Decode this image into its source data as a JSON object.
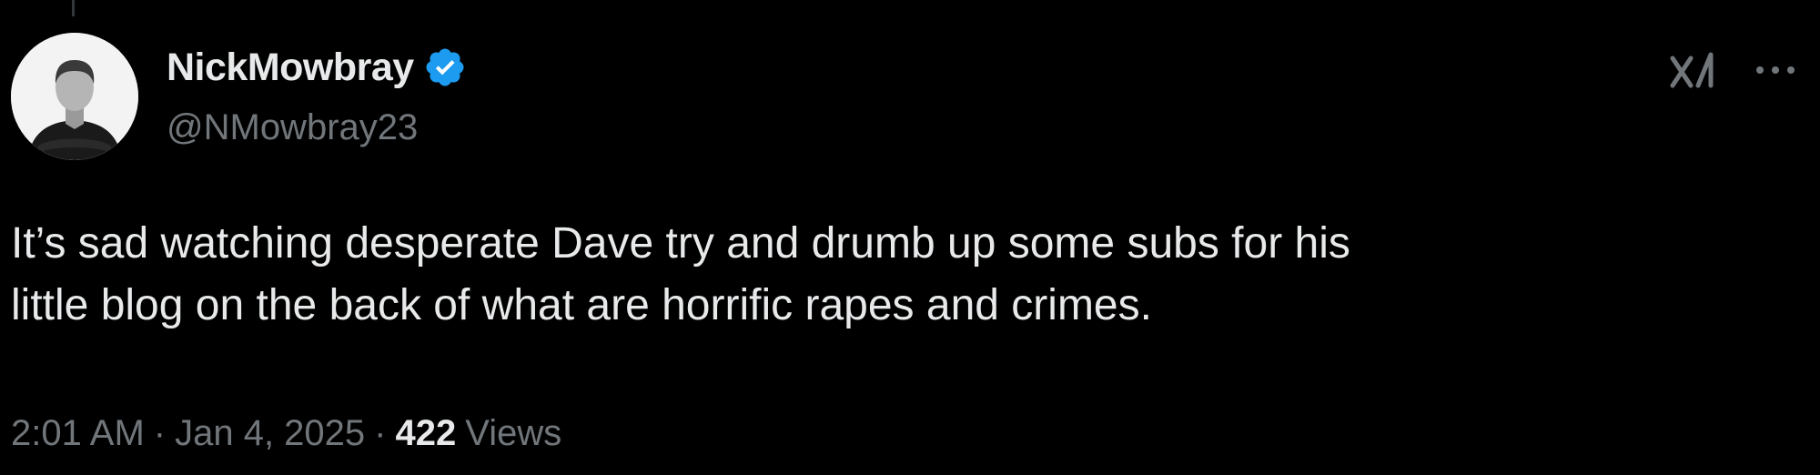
{
  "tweet": {
    "author": {
      "display_name": "NickMowbray",
      "handle": "@NMowbray23",
      "verified": true,
      "avatar_icon": "profile-photo"
    },
    "text": "It’s sad watching desperate Dave try and drumb up some subs for his\nlittle blog on the back of what are horrific rapes and crimes.",
    "time": "2:01 AM",
    "date": "Jan 4, 2025",
    "separator": "·",
    "views_count": "422",
    "views_label": "Views",
    "actions": {
      "grok_icon": "grok-icon",
      "more_icon": "more-options-icon"
    }
  },
  "colors": {
    "background": "#000000",
    "primary_text": "#e7e9ea",
    "secondary_text": "#71767b",
    "verified_blue": "#1d9bf0"
  }
}
